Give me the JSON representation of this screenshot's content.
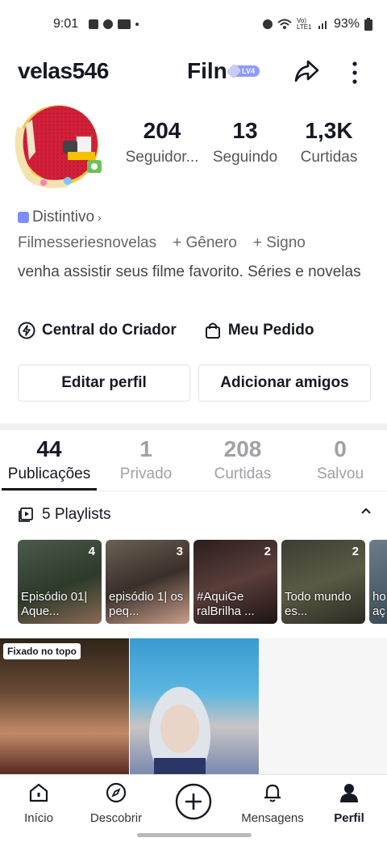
{
  "status_bar": {
    "time": "9:01",
    "battery": "93%",
    "net_label": "Vo) LTE1"
  },
  "header": {
    "username": "velas546",
    "title": "Filn",
    "level_badge": "LV4"
  },
  "profile": {
    "stats": [
      {
        "value": "204",
        "label": "Seguidor..."
      },
      {
        "value": "13",
        "label": "Seguindo"
      },
      {
        "value": "1,3K",
        "label": "Curtidas"
      }
    ],
    "badge_label": "Distintivo",
    "tags": [
      "Filmesseriesnovelas",
      "+ Gênero",
      "+ Signo"
    ],
    "bio": "venha assistir seus filme favorito. Séries e novelas",
    "links": [
      "Central do Criador",
      "Meu Pedido"
    ],
    "edit_button": "Editar perfil",
    "add_friends_button": "Adicionar amigos"
  },
  "tabs": [
    {
      "count": "44",
      "label": "Publicações"
    },
    {
      "count": "1",
      "label": "Privado"
    },
    {
      "count": "208",
      "label": "Curtidas"
    },
    {
      "count": "0",
      "label": "Salvou"
    }
  ],
  "playlists": {
    "header": "5 Playlists",
    "items": [
      {
        "count": "4",
        "title": "Episódio 01| Aque..."
      },
      {
        "count": "3",
        "title": "episódio 1| os peq..."
      },
      {
        "count": "2",
        "title": "#AquiGe ralBrilha ..."
      },
      {
        "count": "2",
        "title": "Todo mundo es..."
      },
      {
        "count": "",
        "title": "ho aç"
      }
    ]
  },
  "grid": {
    "pinned_label": "Fixado no topo"
  },
  "bottom_nav": [
    {
      "label": "Início",
      "icon": "home-icon"
    },
    {
      "label": "Descobrir",
      "icon": "compass-icon"
    },
    {
      "label": "",
      "icon": "plus-icon"
    },
    {
      "label": "Mensagens",
      "icon": "bell-icon"
    },
    {
      "label": "Perfil",
      "icon": "person-icon"
    }
  ],
  "colors": {
    "accent_badge": "#8f9bff",
    "text_primary": "#161823",
    "text_muted": "#a0a0a6"
  }
}
